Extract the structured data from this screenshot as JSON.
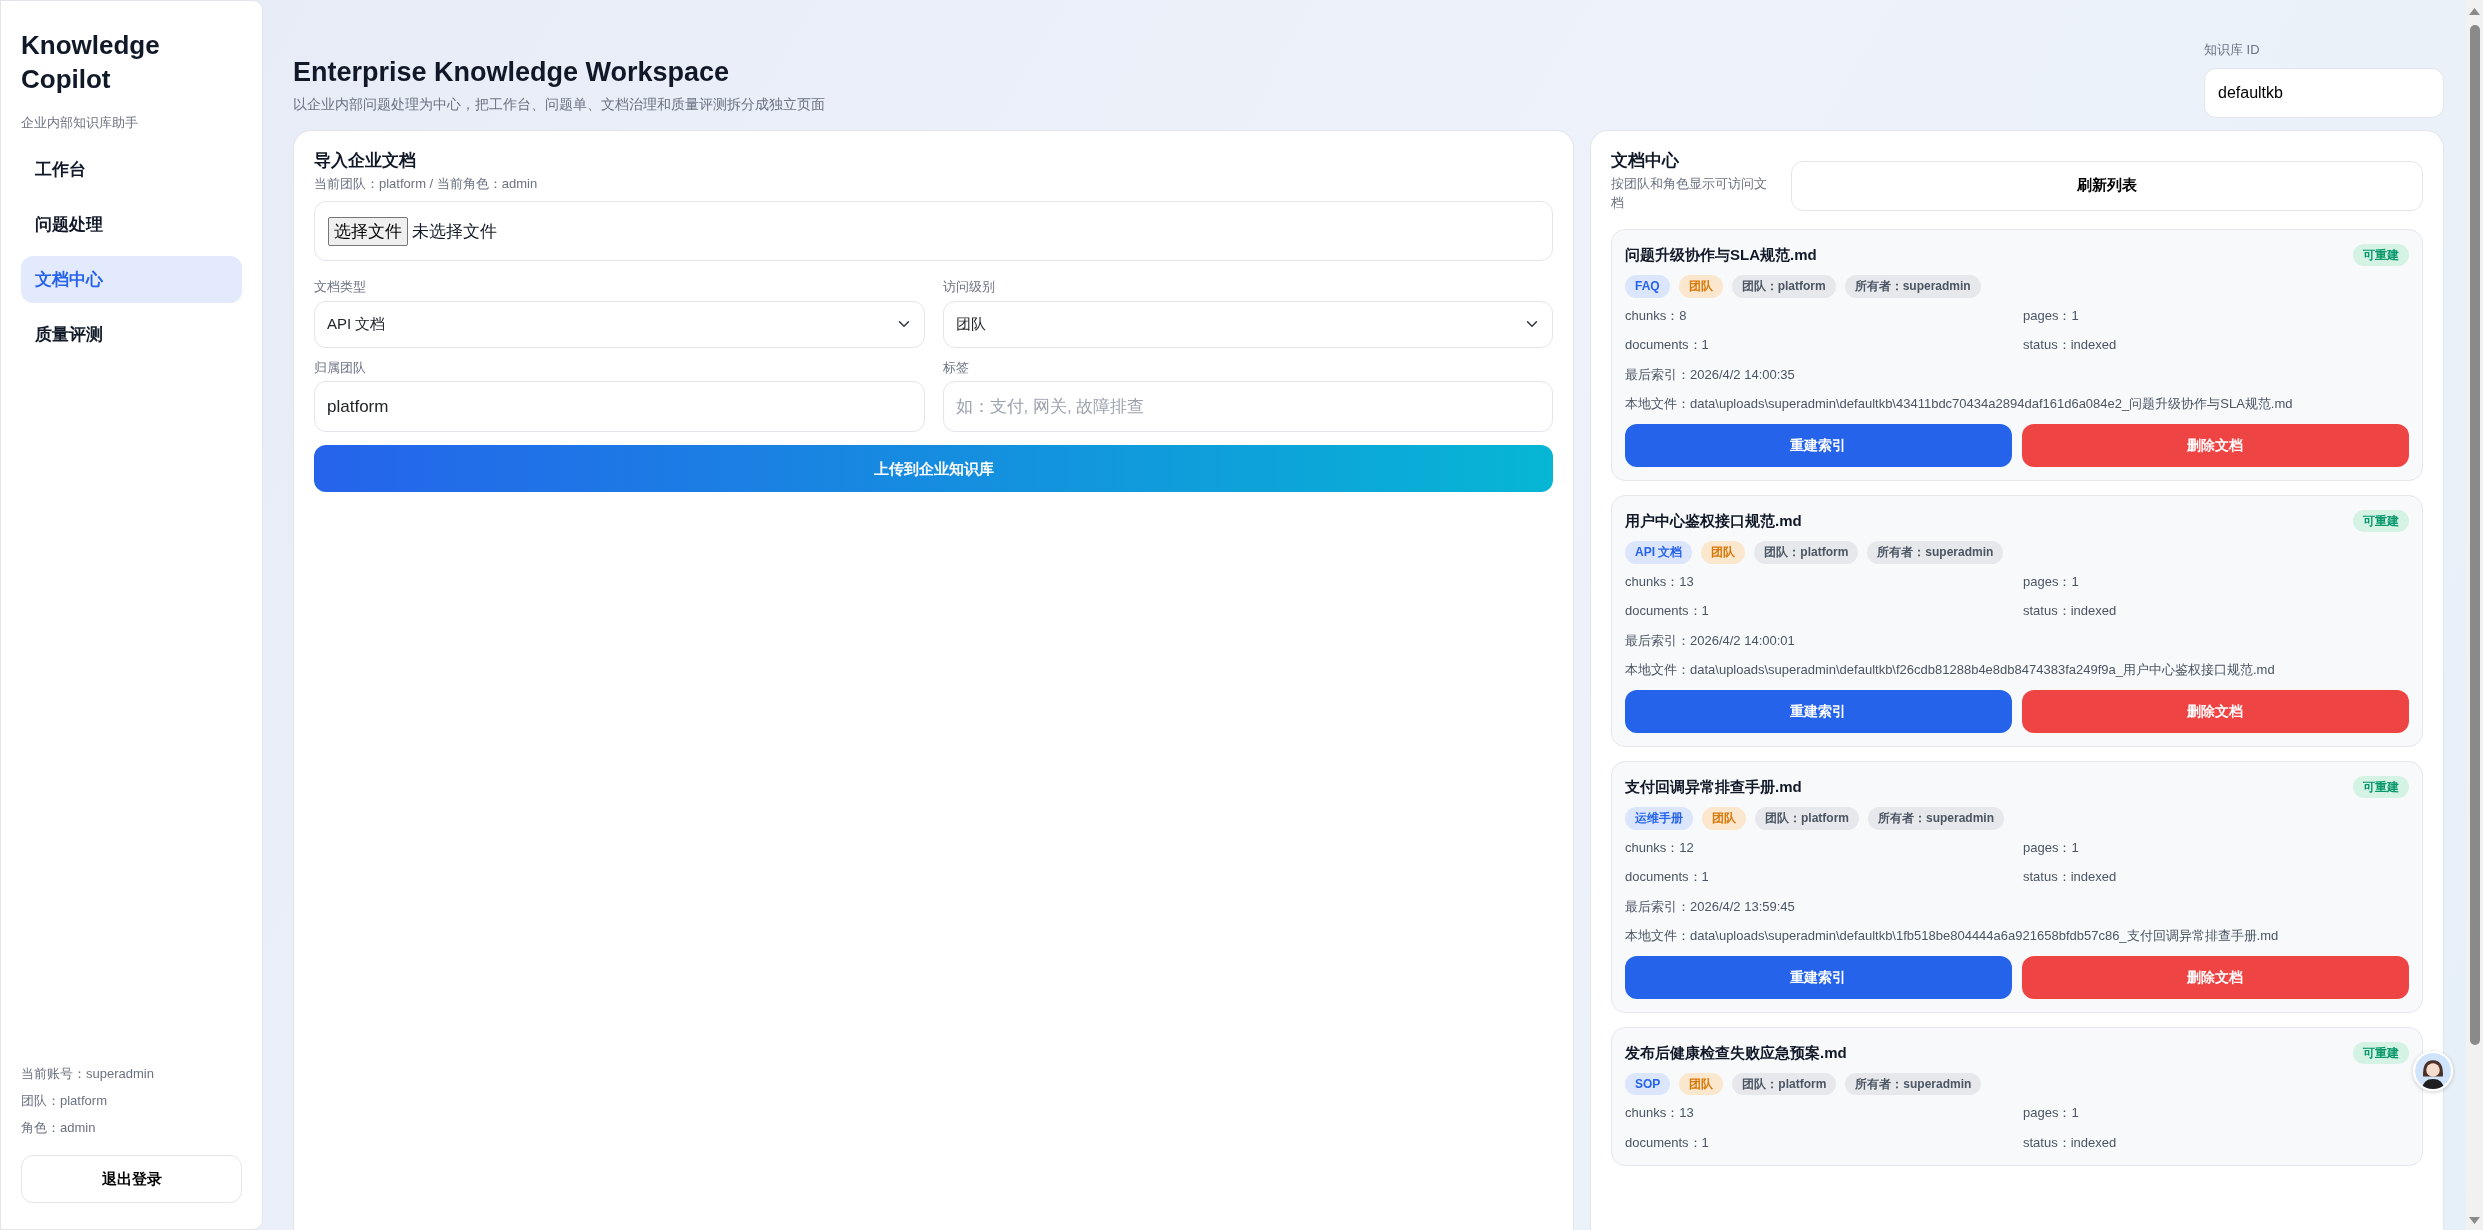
{
  "sidebar": {
    "brand": "Knowledge Copilot",
    "subtitle": "企业内部知识库助手",
    "nav": [
      {
        "label": "工作台",
        "selected": false
      },
      {
        "label": "问题处理",
        "selected": false
      },
      {
        "label": "文档中心",
        "selected": true
      },
      {
        "label": "质量评测",
        "selected": false
      }
    ],
    "account": [
      "当前账号：superadmin",
      "团队：platform",
      "角色：admin"
    ],
    "logout": "退出登录"
  },
  "header": {
    "title": "Enterprise Knowledge Workspace",
    "subtitle": "以企业内部问题处理为中心，把工作台、问题单、文档治理和质量评测拆分成独立页面",
    "kb_label": "知识库 ID",
    "kb_value": "defaultkb"
  },
  "upload": {
    "title": "导入企业文档",
    "context": "当前团队：platform / 当前角色：admin",
    "file": {
      "button": "选择文件",
      "status": "未选择文件"
    },
    "fields": [
      {
        "kind": "select",
        "label": "文档类型",
        "value": "API 文档"
      },
      {
        "kind": "select",
        "label": "访问级别",
        "value": "团队"
      },
      {
        "kind": "input",
        "label": "归属团队",
        "value": "platform"
      },
      {
        "kind": "input",
        "label": "标签",
        "placeholder": "如：支付, 网关, 故障排查"
      }
    ],
    "submit": "上传到企业知识库"
  },
  "documents": {
    "title": "文档中心",
    "subtitle": "按团队和角色显示可访问文档",
    "refresh": "刷新列表",
    "items": [
      {
        "name": "问题升级协作与SLA规范.md",
        "badge": "可重建",
        "tags": [
          {
            "kind": "type",
            "label": "FAQ"
          },
          {
            "kind": "access",
            "label": "团队"
          },
          {
            "kind": "meta",
            "label": "团队：platform"
          },
          {
            "kind": "meta",
            "label": "所有者：superadmin"
          }
        ],
        "stats": [
          "chunks：8",
          "pages：1",
          "documents：1",
          "status：indexed"
        ],
        "lines": [
          "最后索引：2026/4/2 14:00:35",
          "本地文件：data\\uploads\\superadmin\\defaultkb\\43411bdc70434a2894daf161d6a084e2_问题升级协作与SLA规范.md"
        ],
        "actions": [
          {
            "kind": "primary",
            "label": "重建索引"
          },
          {
            "kind": "danger",
            "label": "删除文档"
          }
        ]
      },
      {
        "name": "用户中心鉴权接口规范.md",
        "badge": "可重建",
        "tags": [
          {
            "kind": "type",
            "label": "API 文档"
          },
          {
            "kind": "access",
            "label": "团队"
          },
          {
            "kind": "meta",
            "label": "团队：platform"
          },
          {
            "kind": "meta",
            "label": "所有者：superadmin"
          }
        ],
        "stats": [
          "chunks：13",
          "pages：1",
          "documents：1",
          "status：indexed"
        ],
        "lines": [
          "最后索引：2026/4/2 14:00:01",
          "本地文件：data\\uploads\\superadmin\\defaultkb\\f26cdb81288b4e8db8474383fa249f9a_用户中心鉴权接口规范.md"
        ],
        "actions": [
          {
            "kind": "primary",
            "label": "重建索引"
          },
          {
            "kind": "danger",
            "label": "删除文档"
          }
        ]
      },
      {
        "name": "支付回调异常排查手册.md",
        "badge": "可重建",
        "tags": [
          {
            "kind": "type",
            "label": "运维手册"
          },
          {
            "kind": "access",
            "label": "团队"
          },
          {
            "kind": "meta",
            "label": "团队：platform"
          },
          {
            "kind": "meta",
            "label": "所有者：superadmin"
          }
        ],
        "stats": [
          "chunks：12",
          "pages：1",
          "documents：1",
          "status：indexed"
        ],
        "lines": [
          "最后索引：2026/4/2 13:59:45",
          "本地文件：data\\uploads\\superadmin\\defaultkb\\1fb518be804444a6a921658bfdb57c86_支付回调异常排查手册.md"
        ],
        "actions": [
          {
            "kind": "primary",
            "label": "重建索引"
          },
          {
            "kind": "danger",
            "label": "删除文档"
          }
        ]
      },
      {
        "name": "发布后健康检查失败应急预案.md",
        "badge": "可重建",
        "tags": [
          {
            "kind": "type",
            "label": "SOP"
          },
          {
            "kind": "access",
            "label": "团队"
          },
          {
            "kind": "meta",
            "label": "团队：platform"
          },
          {
            "kind": "meta",
            "label": "所有者：superadmin"
          }
        ],
        "stats": [
          "chunks：13",
          "pages：1",
          "documents：1",
          "status：indexed"
        ]
      }
    ]
  }
}
